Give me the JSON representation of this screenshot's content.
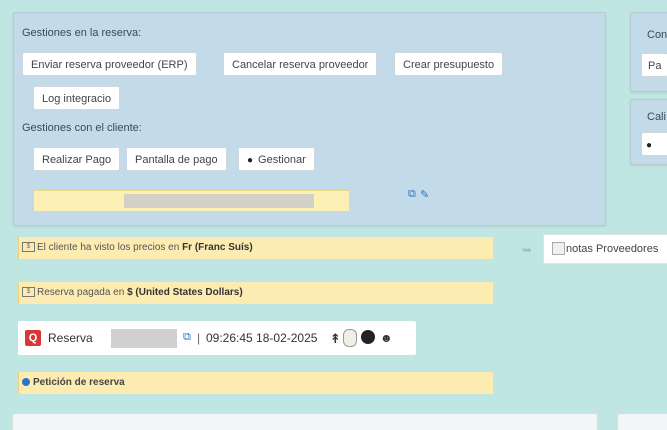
{
  "reserva_gestion": {
    "heading": "Gestiones en la reserva:",
    "buttons": {
      "enviar": "Enviar reserva proveedor (ERP)",
      "cancelar": "Cancelar reserva proveedor",
      "presupuesto": "Crear presupuesto",
      "log": "Log integracio"
    }
  },
  "cliente_gestion": {
    "heading": "Gestiones con el cliente:",
    "buttons": {
      "pago": "Realizar Pago",
      "pantalla": "Pantalla de pago",
      "gestionar": "Gestionar"
    }
  },
  "right_panels": {
    "panel1_title": "Con",
    "panel1_button": "Pa",
    "panel2_title": "Cali"
  },
  "info": {
    "precios_prefix": "El cliente ha visto los precios en ",
    "precios_value": "Fr (Franc Suís)",
    "pagada_prefix": "Reserva pagada en ",
    "pagada_value": "$ (United States Dollars)",
    "peticion": "Petición de reserva"
  },
  "notas": {
    "alt_text": "notas Proveedores"
  },
  "reserva_card": {
    "label": "Reserva",
    "separator": "|",
    "datetime": "09:26:45 18-02-2025"
  },
  "icons": {
    "card_brand": "letter-q-brand-icon",
    "copy": "copy-icon",
    "edit": "edit-icon",
    "comment": "comment-icon",
    "transfer": "arrow-icon",
    "money": "money-icon",
    "person_arrow": "person-arrow-icon",
    "circle_bolt": "bolt-circle-icon",
    "user": "user-icon",
    "info": "info-icon"
  },
  "colors": {
    "page_bg": "#bfe6e2",
    "panel_bg": "#c3dbe9",
    "info_bar_bg": "#fdecb2",
    "field_bg": "#fdf0b5",
    "brand_red": "#d9363a",
    "link_blue": "#2a76c6"
  }
}
